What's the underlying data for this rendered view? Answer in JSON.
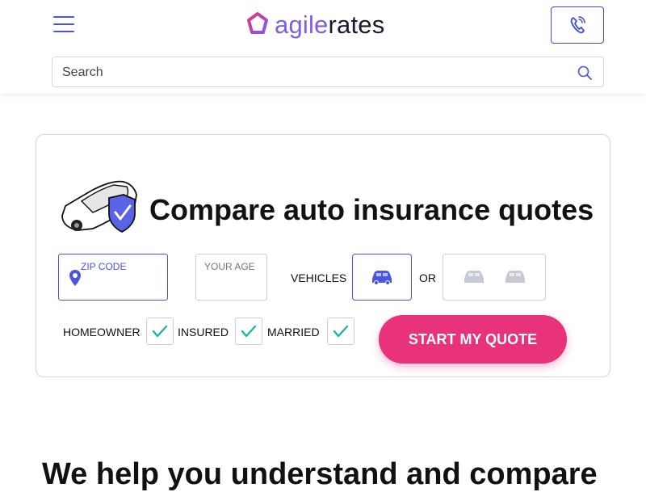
{
  "header": {
    "logo": {
      "part1": "agile",
      "part2": "rates"
    },
    "search": {
      "placeholder": "Search"
    }
  },
  "quote_card": {
    "title": "Compare auto insurance quotes",
    "zip_label": "ZIP CODE",
    "age_label": "YOUR AGE",
    "vehicles_label": "VEHICLES",
    "or_label": "OR",
    "checkboxes": [
      {
        "label": "HOMEOWNER",
        "checked": true
      },
      {
        "label": "INSURED",
        "checked": true
      },
      {
        "label": "MARRIED",
        "checked": true
      }
    ],
    "cta_label": "START MY QUOTE"
  },
  "section": {
    "headline": "We help you understand and compare"
  },
  "colors": {
    "accent": "#4a55e0",
    "cta": "#e8327a",
    "check": "#1fb6a6"
  }
}
